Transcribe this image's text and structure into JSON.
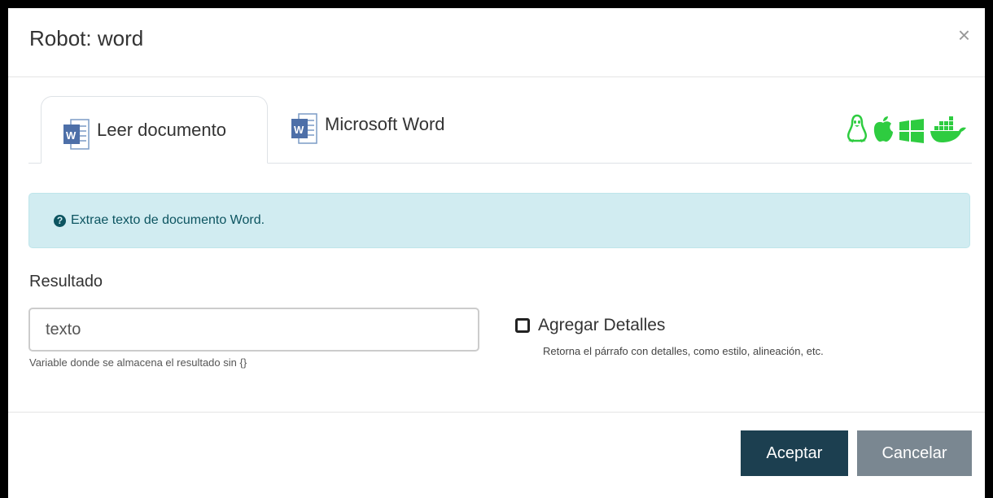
{
  "modal": {
    "title": "Robot: word",
    "close_glyph": "×"
  },
  "tabs": [
    {
      "label": "Leer documento",
      "icon": "word-icon",
      "active": true
    },
    {
      "label": "Microsoft Word",
      "icon": "word-icon",
      "active": false
    }
  ],
  "os_icons": [
    "linux-icon",
    "apple-icon",
    "windows-icon",
    "docker-icon"
  ],
  "info": {
    "icon": "question-circle-icon",
    "text": "Extrae texto de documento Word."
  },
  "result": {
    "label": "Resultado",
    "value": "texto",
    "help": "Variable donde se almacena el resultado sin {}"
  },
  "details": {
    "label": "Agregar Detalles",
    "checked": false,
    "help": "Retorna el párrafo con detalles, como estilo, alineación, etc."
  },
  "footer": {
    "accept_label": "Aceptar",
    "cancel_label": "Cancelar"
  },
  "colors": {
    "os_icon_green": "#2ecc40",
    "primary_button": "#1c3f50",
    "secondary_button": "#7a8791",
    "info_background": "#d1ecf1",
    "info_text": "#0c5460"
  }
}
